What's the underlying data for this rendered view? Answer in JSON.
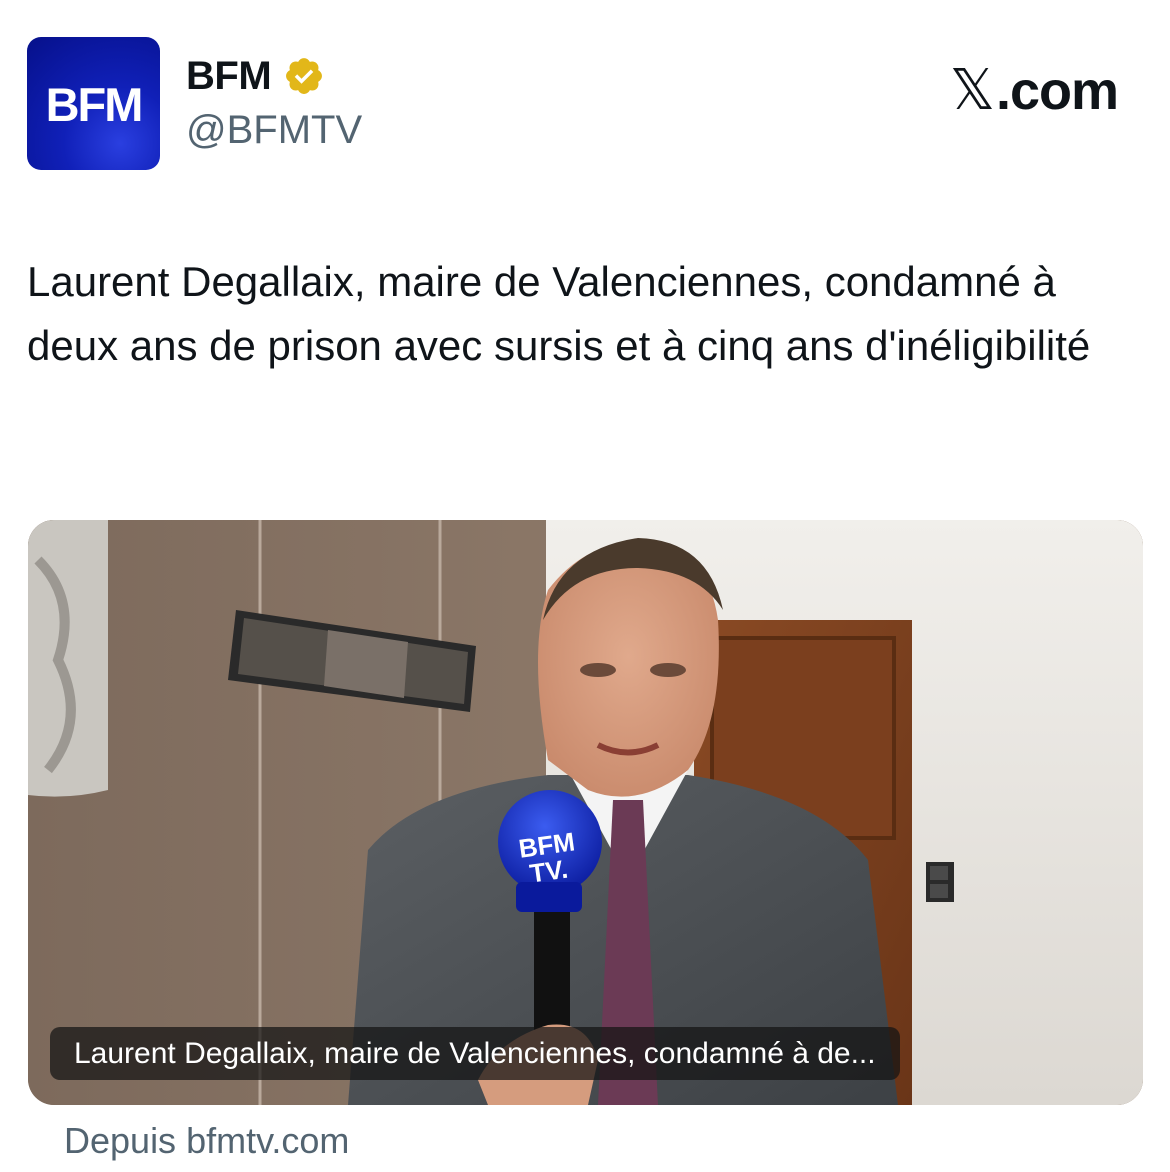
{
  "account": {
    "avatar_text": "BFM",
    "display_name": "BFM",
    "handle": "@BFMTV",
    "verified_badge_icon": "gold-verified-badge-icon"
  },
  "platform": {
    "label": ".com",
    "logo_glyph": "𝕏"
  },
  "tweet": {
    "text": "Laurent Degallaix, maire de Valenciennes, condamné à deux ans de prison avec sursis et à cinq ans d'inéligibilité"
  },
  "media": {
    "caption": "Laurent Degallaix, maire de Valenciennes, condamné à de...",
    "mic_flag_line1": "BFM",
    "mic_flag_line2": "TV."
  },
  "source": {
    "label": "Depuis bfmtv.com"
  },
  "colors": {
    "brand_blue": "#0b1aa8",
    "verified_gold": "#e2b719",
    "text_primary": "#0f1419",
    "text_secondary": "#536471"
  }
}
